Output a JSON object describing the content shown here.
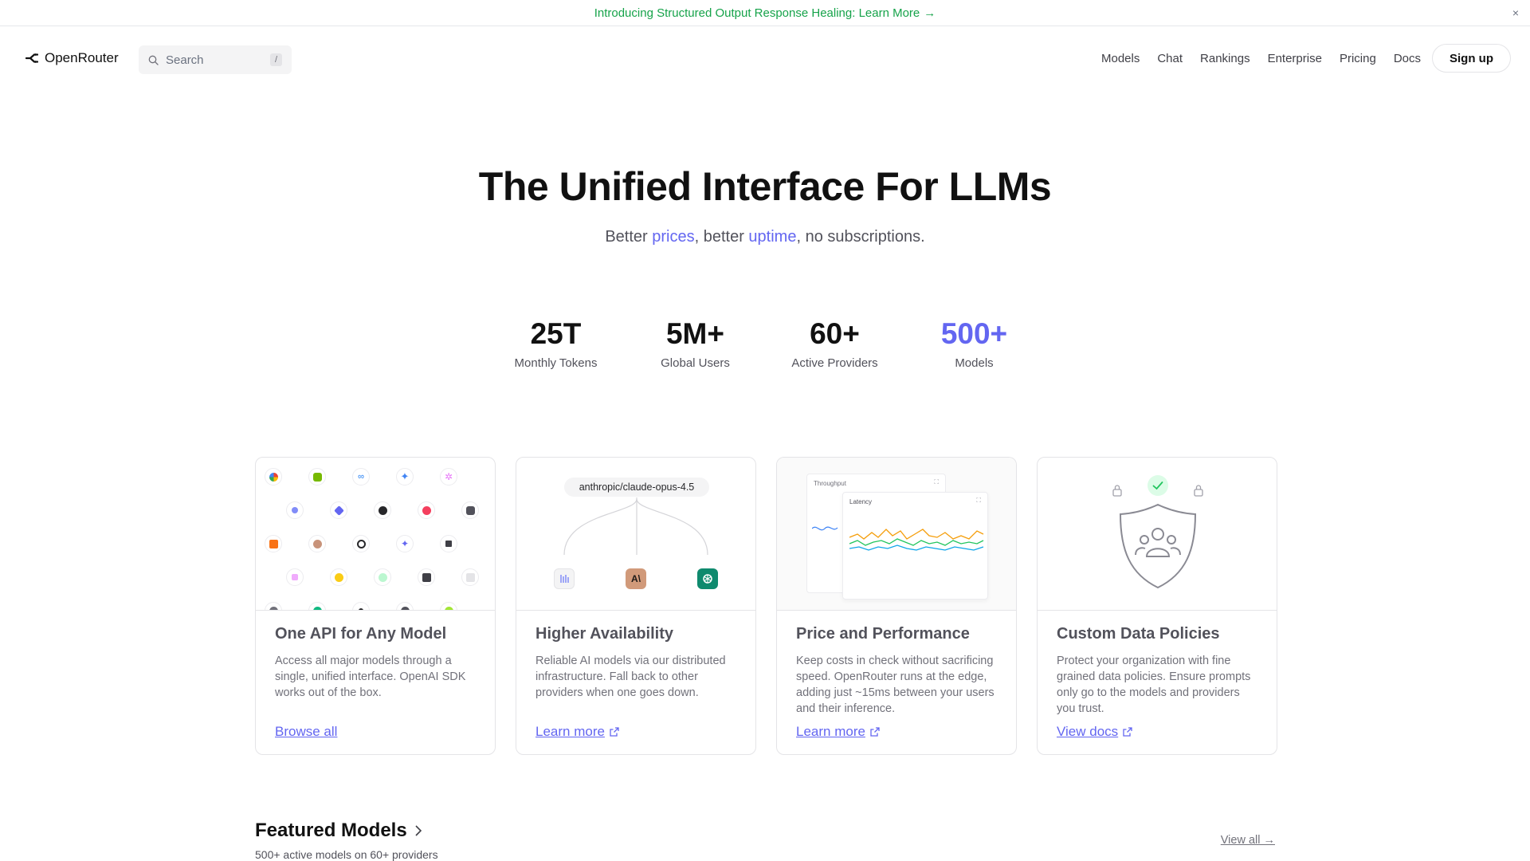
{
  "banner": {
    "text": "Introducing Structured Output Response Healing: Learn More",
    "arrow": "→",
    "close": "×"
  },
  "header": {
    "brand": "OpenRouter",
    "search_placeholder": "Search",
    "search_shortcut": "/",
    "nav": [
      "Models",
      "Chat",
      "Rankings",
      "Enterprise",
      "Pricing",
      "Docs"
    ],
    "signup": "Sign up"
  },
  "hero": {
    "title": "The Unified Interface For LLMs",
    "sub_before": "Better ",
    "sub_link1": "prices",
    "sub_middle": ", better ",
    "sub_link2": "uptime",
    "sub_after": ", no subscriptions."
  },
  "stats": [
    {
      "value": "25T",
      "label": "Monthly Tokens"
    },
    {
      "value": "5M+",
      "label": "Global Users"
    },
    {
      "value": "60+",
      "label": "Active Providers"
    },
    {
      "value": "500+",
      "label": "Models"
    }
  ],
  "cards": [
    {
      "title": "One API for Any Model",
      "desc": "Access all major models through a single, unified interface. OpenAI SDK works out of the box.",
      "link": "Browse all"
    },
    {
      "title": "Higher Availability",
      "desc": "Reliable AI models via our distributed infrastructure. Fall back to other providers when one goes down.",
      "link": "Learn more"
    },
    {
      "title": "Price and Performance",
      "desc": "Keep costs in check without sacrificing speed. OpenRouter runs at the edge, adding just ~15ms between your users and their inference.",
      "link": "Learn more"
    },
    {
      "title": "Custom Data Policies",
      "desc": "Protect your organization with fine grained data policies. Ensure prompts only go to the models and providers you trust.",
      "link": "View docs"
    }
  ],
  "availability_visual": {
    "model": "anthropic/claude-opus-4.5",
    "provider_mark": "A\\"
  },
  "performance_visual": {
    "panel_back": "Throughput",
    "panel_front": "Latency"
  },
  "featured": {
    "title": "Featured Models",
    "subtitle": "500+ active models on 60+ providers",
    "view_all": "View all →"
  },
  "colors": {
    "accent": "#6366f1",
    "banner_green": "#16a34a",
    "policy_check": "#22c55e"
  }
}
